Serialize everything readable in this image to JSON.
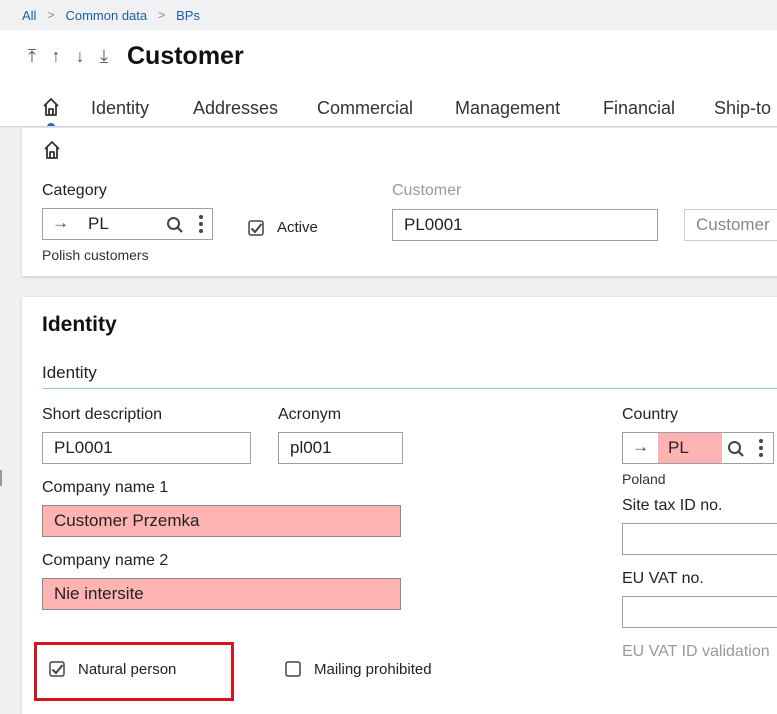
{
  "breadcrumb": {
    "items": [
      "All",
      "Common data",
      "BPs"
    ]
  },
  "header": {
    "title": "Customer",
    "nav_icons": [
      "first-record-icon",
      "previous-record-icon",
      "next-record-icon",
      "last-record-icon"
    ]
  },
  "tabs": [
    "Identity",
    "Addresses",
    "Commercial",
    "Management",
    "Financial",
    "Ship-to"
  ],
  "top_card": {
    "category_label": "Category",
    "category_value": "PL",
    "category_desc": "Polish customers",
    "active_label": "Active",
    "active_checked": true,
    "customer_label": "Customer",
    "customer_value": "PL0001",
    "customer2_value": "Customer"
  },
  "identity": {
    "section_title": "Identity",
    "subsection_title": "Identity",
    "short_desc_label": "Short description",
    "short_desc_value": "PL0001",
    "acronym_label": "Acronym",
    "acronym_value": "pl001",
    "company1_label": "Company name 1",
    "company1_value": "Customer Przemka",
    "company2_label": "Company name 2",
    "company2_value": "Nie intersite",
    "country_label": "Country",
    "country_value": "PL",
    "country_desc": "Poland",
    "site_tax_label": "Site tax ID no.",
    "site_tax_value": "",
    "eu_vat_label": "EU VAT no.",
    "eu_vat_value": "",
    "eu_vat_validation_label": "EU VAT ID validation",
    "natural_person_label": "Natural person",
    "natural_person_checked": true,
    "mailing_label": "Mailing prohibited",
    "mailing_checked": false
  },
  "colors": {
    "accent": "#1f6ad1",
    "link": "#1a5fa8",
    "mandatory": "#ffb3b3",
    "highlight": "#d9141e"
  }
}
